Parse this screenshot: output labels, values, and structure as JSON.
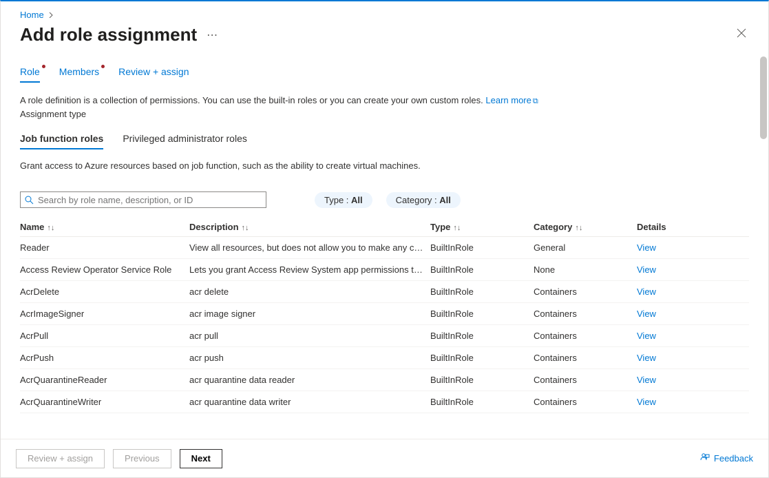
{
  "breadcrumb": {
    "home": "Home"
  },
  "title": "Add role assignment",
  "tabs": {
    "role": "Role",
    "members": "Members",
    "review": "Review + assign"
  },
  "helptext": "A role definition is a collection of permissions. You can use the built-in roles or you can create your own custom roles.",
  "learn_more": "Learn more",
  "assignment_type_label": "Assignment type",
  "subtabs": {
    "job": "Job function roles",
    "priv": "Privileged administrator roles"
  },
  "grant_text": "Grant access to Azure resources based on job function, such as the ability to create virtual machines.",
  "search": {
    "placeholder": "Search by role name, description, or ID"
  },
  "filters": {
    "type_label": "Type : ",
    "type_value": "All",
    "cat_label": "Category : ",
    "cat_value": "All"
  },
  "columns": {
    "name": "Name",
    "desc": "Description",
    "type": "Type",
    "cat": "Category",
    "details": "Details"
  },
  "view_label": "View",
  "rows": [
    {
      "name": "Reader",
      "desc": "View all resources, but does not allow you to make any ch…",
      "type": "BuiltInRole",
      "cat": "General"
    },
    {
      "name": "Access Review Operator Service Role",
      "desc": "Lets you grant Access Review System app permissions to …",
      "type": "BuiltInRole",
      "cat": "None"
    },
    {
      "name": "AcrDelete",
      "desc": "acr delete",
      "type": "BuiltInRole",
      "cat": "Containers"
    },
    {
      "name": "AcrImageSigner",
      "desc": "acr image signer",
      "type": "BuiltInRole",
      "cat": "Containers"
    },
    {
      "name": "AcrPull",
      "desc": "acr pull",
      "type": "BuiltInRole",
      "cat": "Containers"
    },
    {
      "name": "AcrPush",
      "desc": "acr push",
      "type": "BuiltInRole",
      "cat": "Containers"
    },
    {
      "name": "AcrQuarantineReader",
      "desc": "acr quarantine data reader",
      "type": "BuiltInRole",
      "cat": "Containers"
    },
    {
      "name": "AcrQuarantineWriter",
      "desc": "acr quarantine data writer",
      "type": "BuiltInRole",
      "cat": "Containers"
    }
  ],
  "footer": {
    "review": "Review + assign",
    "prev": "Previous",
    "next": "Next",
    "feedback": "Feedback"
  }
}
